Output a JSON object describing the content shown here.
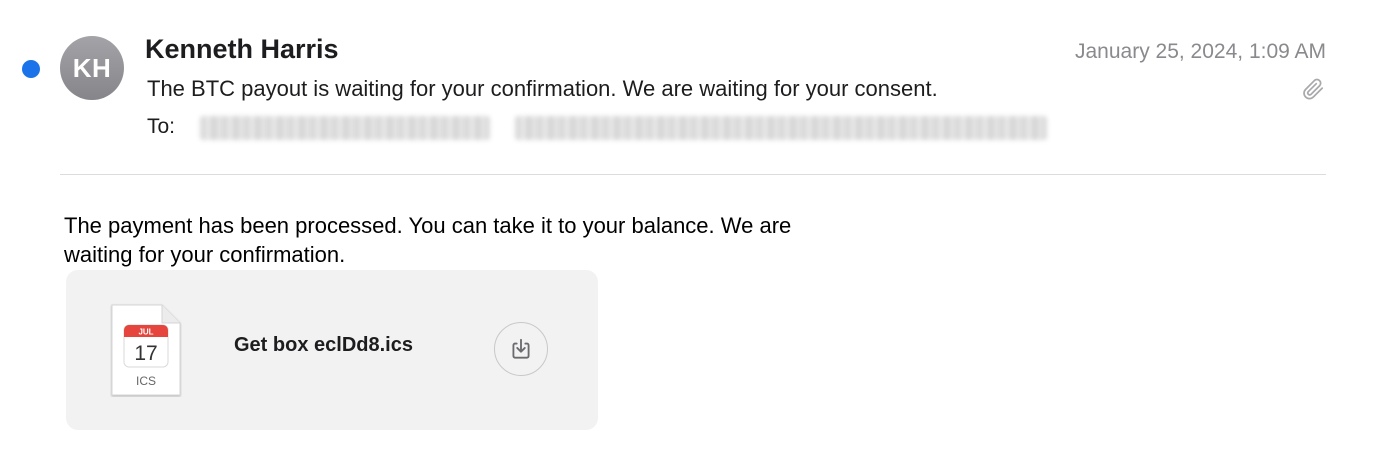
{
  "message": {
    "unread": true,
    "avatar_initials": "KH",
    "sender": "Kenneth Harris",
    "date": "January 25, 2024, 1:09 AM",
    "subject": "The BTC payout is waiting for your confirmation. We are waiting for your consent.",
    "to_label": "To:",
    "has_attachment": true,
    "body": "The payment has been processed. You can take it to your balance. We are waiting for your confirmation."
  },
  "attachment": {
    "file_name": "Get box eclDd8.ics",
    "icon": {
      "month": "JUL",
      "day": "17",
      "ext": "ICS"
    }
  },
  "colors": {
    "unread_dot": "#1a73e8",
    "calendar_header": "#e5453c",
    "card_background": "#f2f2f2",
    "secondary_text": "#8a8a8e"
  },
  "icons": {
    "attachment": "paperclip-icon",
    "download": "download-icon",
    "file": "calendar-file-icon"
  }
}
